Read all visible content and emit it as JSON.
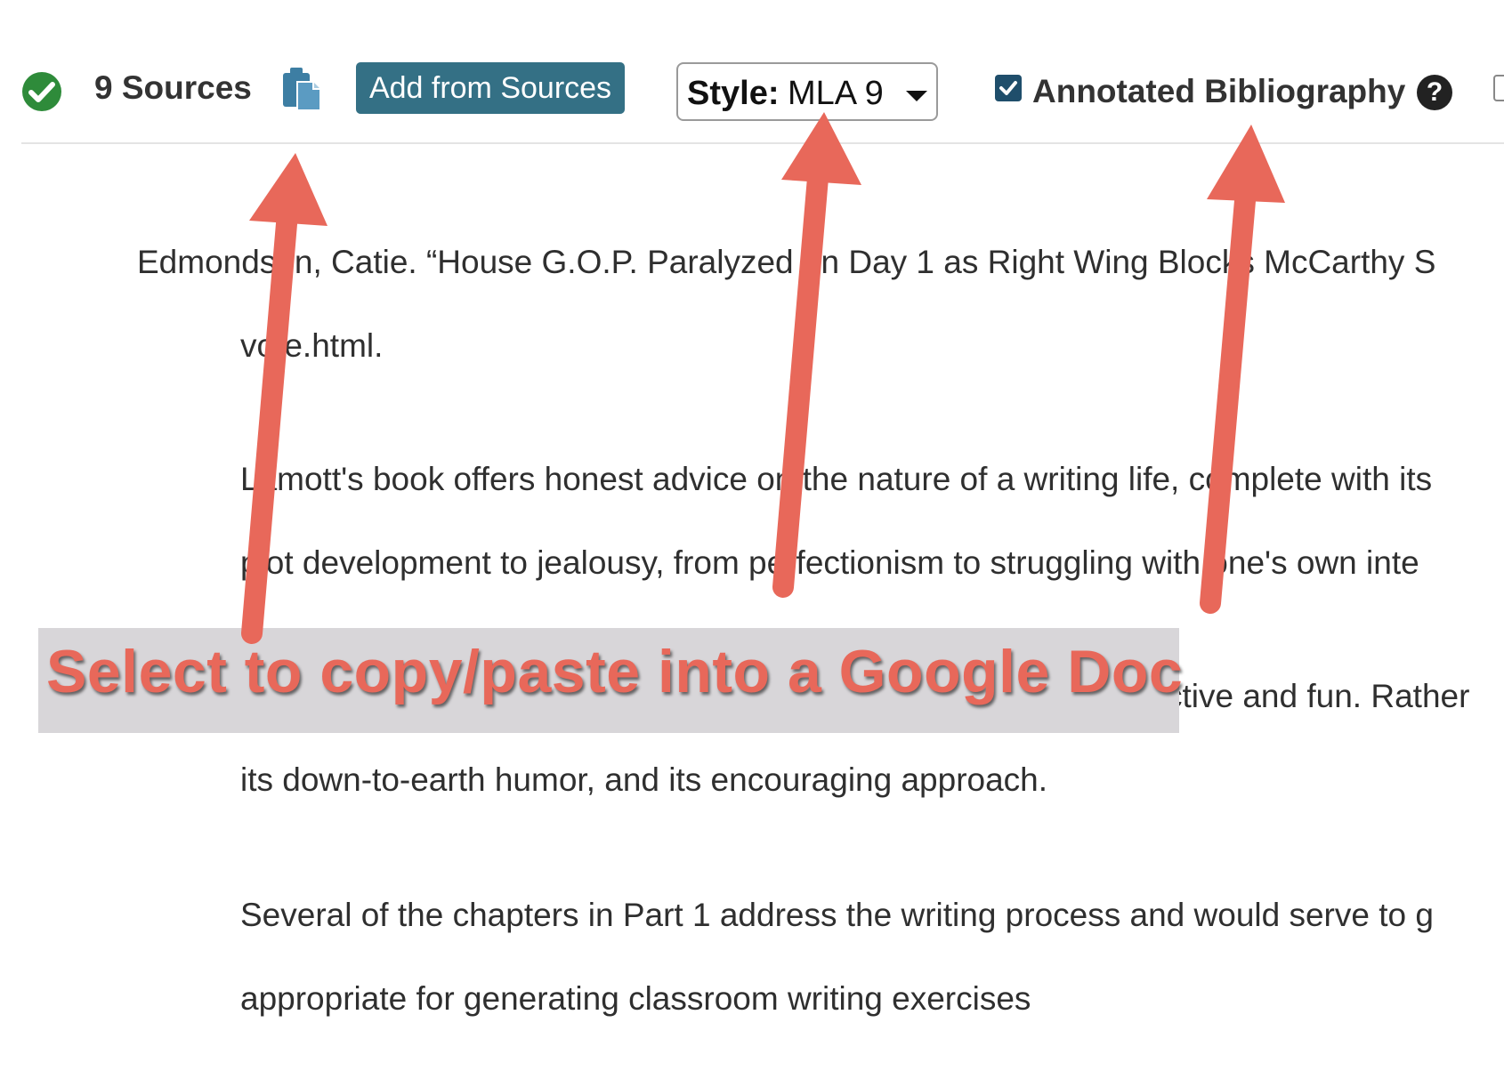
{
  "toolbar": {
    "check_icon": "check-circle-icon",
    "sources_count": "9 Sources",
    "copy_icon": "copy-clipboard-icon",
    "add_button_label": "Add from Sources",
    "style_label": "Style:",
    "style_value": "MLA 9",
    "annotated_checked": true,
    "annotated_label": "Annotated Bibliography",
    "help_label": "?"
  },
  "document": {
    "citation_line1": "Edmondson, Catie. “House G.O.P. Paralyzed on Day 1 as Right Wing Blocks McCarthy S",
    "citation_line2": "vote.html.",
    "annotation1_line1": "Lamott's book offers honest advice on the nature of a writing life, complete with its",
    "annotation1_line2": "plot development to jealousy, from perfectionism to struggling with one's own inte",
    "annotation2_line1": "ctive and fun. Rather",
    "annotation2_line2": "its down-to-earth humor, and its encouraging approach.",
    "annotation3_line1": "Several of the chapters in Part 1 address the writing process and would serve to g",
    "annotation3_line2": "appropriate for generating classroom writing exercises"
  },
  "overlay": {
    "caption": "Select to copy/paste into a Google Doc",
    "arrow_color": "#e8685a",
    "caption_bg": "#d8d6d9"
  },
  "colors": {
    "accent_button": "#347085",
    "check_green": "#2e8b3a",
    "checkbox_blue": "#1f4e6b"
  }
}
